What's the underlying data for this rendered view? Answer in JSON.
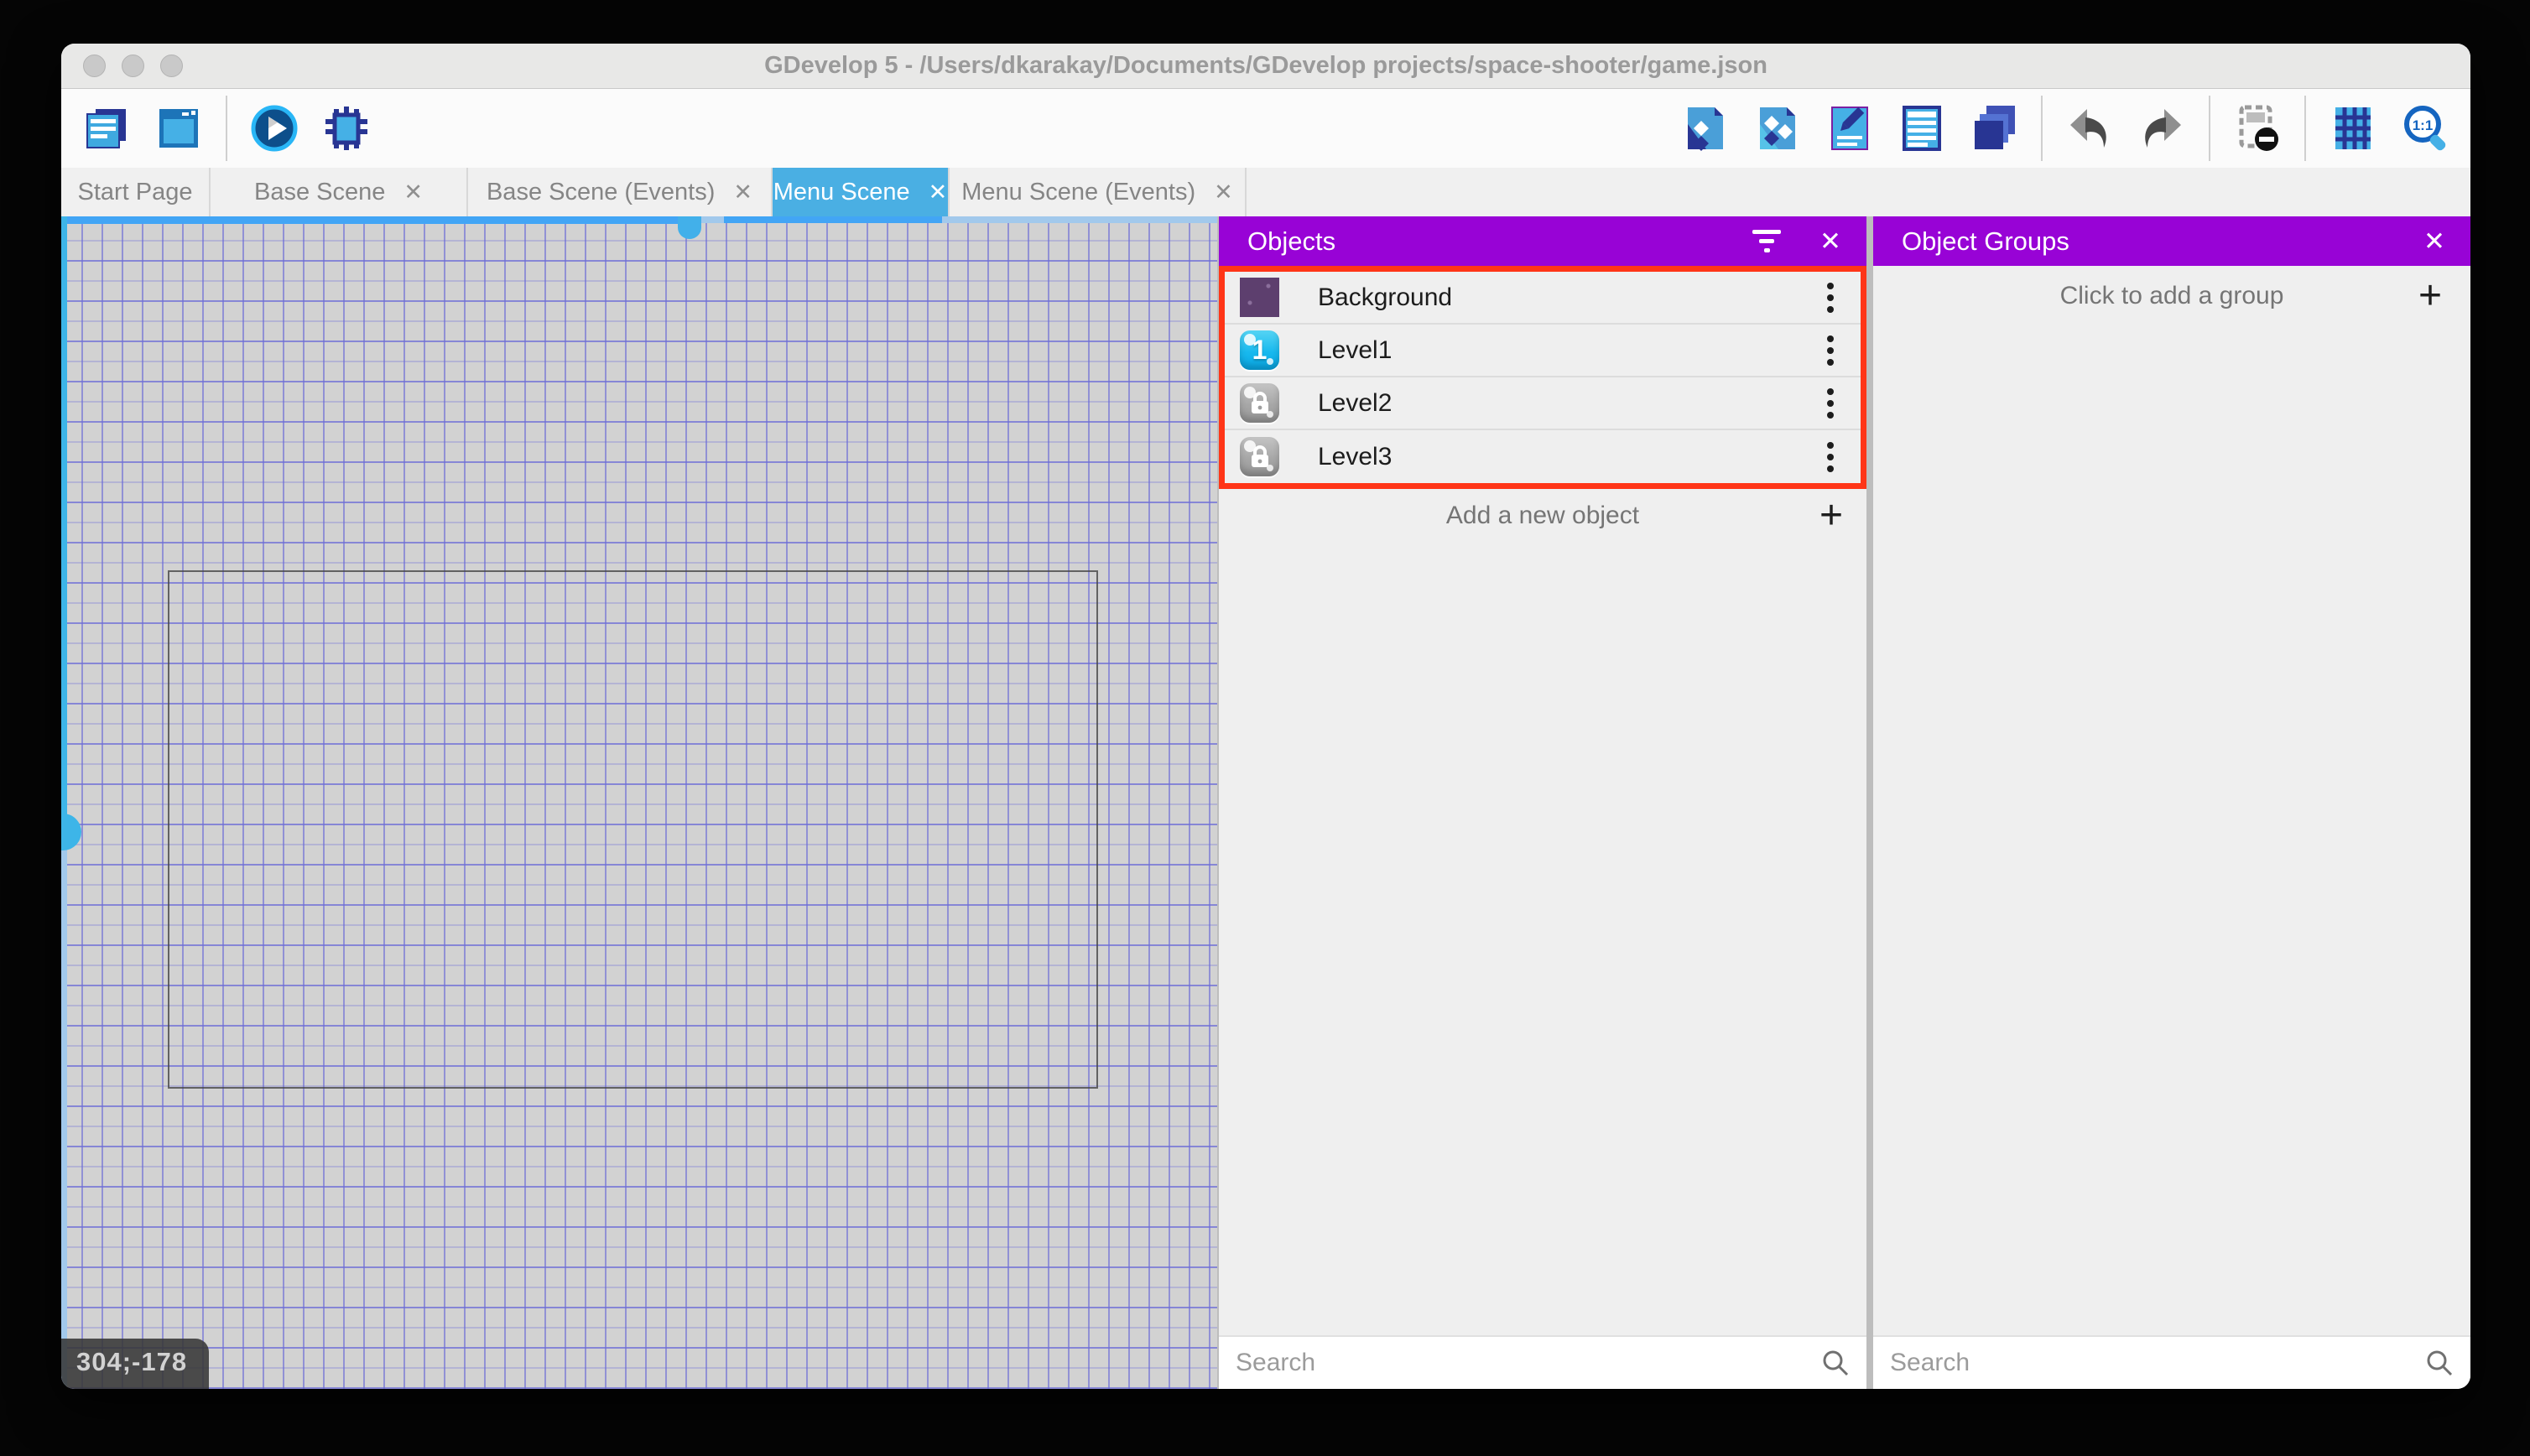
{
  "window": {
    "title": "GDevelop 5 - /Users/dkarakay/Documents/GDevelop projects/space-shooter/game.json"
  },
  "toolbar": {
    "left_icons": [
      "project-manager-icon",
      "scene-properties-icon",
      "play-preview-icon",
      "debug-icon"
    ],
    "right_icons": [
      "objects-panel-icon",
      "object-groups-icon",
      "properties-icon",
      "instances-list-icon",
      "layers-icon",
      "undo-icon",
      "redo-icon",
      "render-mask-icon",
      "grid-icon",
      "zoom-1-1-icon"
    ]
  },
  "tabs": [
    {
      "label": "Start Page",
      "closable": false,
      "active": false
    },
    {
      "label": "Base Scene",
      "closable": true,
      "active": false
    },
    {
      "label": "Base Scene (Events)",
      "closable": true,
      "active": false
    },
    {
      "label": "Menu Scene",
      "closable": true,
      "active": true
    },
    {
      "label": "Menu Scene (Events)",
      "closable": true,
      "active": false
    }
  ],
  "tab_close_glyph": "✕",
  "canvas": {
    "coordinates_badge": "304;-178"
  },
  "objects_panel": {
    "title": "Objects",
    "close_glyph": "✕",
    "items": [
      {
        "name": "Background",
        "icon": "background-thumbnail"
      },
      {
        "name": "Level1",
        "icon": "level1-button-thumbnail",
        "badge": "1"
      },
      {
        "name": "Level2",
        "icon": "locked-button-thumbnail"
      },
      {
        "name": "Level3",
        "icon": "locked-button-thumbnail"
      }
    ],
    "add_label": "Add a new object",
    "add_glyph": "+",
    "search_placeholder": "Search"
  },
  "groups_panel": {
    "title": "Object Groups",
    "close_glyph": "✕",
    "add_label": "Click to add a group",
    "add_glyph": "+",
    "search_placeholder": "Search"
  },
  "colors": {
    "accent": "#9803d6",
    "active_tab": "#4aafe3",
    "highlight": "#ff3517",
    "selection": "#42a5f5",
    "selection_light": "#a2c9ec"
  }
}
